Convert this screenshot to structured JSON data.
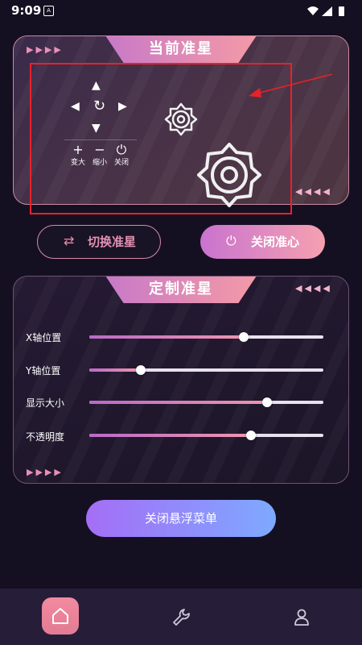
{
  "status_bar": {
    "time": "9:09",
    "notification_icon": "A",
    "icons": [
      "wifi-icon",
      "signal-icon",
      "battery-icon"
    ]
  },
  "current_crosshair": {
    "title": "当前准星",
    "controls": {
      "enlarge": "变大",
      "shrink": "缩小",
      "close": "关闭"
    }
  },
  "actions": {
    "switch_label": "切换准星",
    "close_label": "关闭准心"
  },
  "custom_crosshair": {
    "title": "定制准星",
    "sliders": [
      {
        "label": "X轴位置",
        "value": 0.66
      },
      {
        "label": "Y轴位置",
        "value": 0.22
      },
      {
        "label": "显示大小",
        "value": 0.76
      },
      {
        "label": "不透明度",
        "value": 0.69
      }
    ]
  },
  "close_menu_label": "关闭悬浮菜单",
  "bottom_nav": [
    "home-icon",
    "wrench-icon",
    "user-icon"
  ],
  "colors": {
    "background": "#151021",
    "accent_pink": "#f49aa6",
    "accent_purple": "#c879c8",
    "annotation_red": "#e8212b"
  }
}
